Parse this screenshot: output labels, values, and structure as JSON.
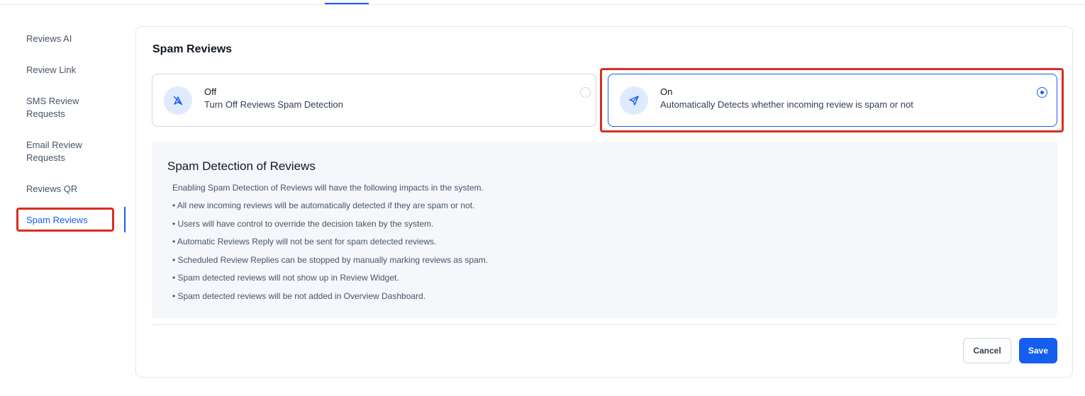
{
  "sidebar": {
    "items": [
      {
        "label": "Reviews AI"
      },
      {
        "label": "Review Link"
      },
      {
        "label": "SMS Review Requests"
      },
      {
        "label": "Email Review Requests"
      },
      {
        "label": "Reviews QR"
      },
      {
        "label": "Spam Reviews",
        "active": true
      }
    ]
  },
  "card": {
    "title": "Spam Reviews",
    "options": {
      "off": {
        "title": "Off",
        "description": "Turn Off Reviews Spam Detection",
        "icon": "send-off-icon",
        "selected": false
      },
      "on": {
        "title": "On",
        "description": "Automatically Detects whether incoming review is spam or not",
        "icon": "send-icon",
        "selected": true
      }
    },
    "info": {
      "title": "Spam Detection of Reviews",
      "lines": [
        "Enabling Spam Detection of Reviews will have the following impacts in the system.",
        "• All new incoming reviews will be automatically detected if they are spam or not.",
        "• Users will have control to override the decision taken by the system.",
        "• Automatic Reviews Reply will not be sent for spam detected reviews.",
        "• Scheduled Review Replies can be stopped by manually marking reviews as spam.",
        "• Spam detected reviews will not show up in Review Widget.",
        "• Spam detected reviews will be not added in Overview Dashboard."
      ]
    },
    "actions": {
      "cancel_label": "Cancel",
      "save_label": "Save"
    }
  },
  "colors": {
    "accent": "#155eef",
    "highlight": "#d92d20",
    "info_bg": "#f5f7fa"
  }
}
